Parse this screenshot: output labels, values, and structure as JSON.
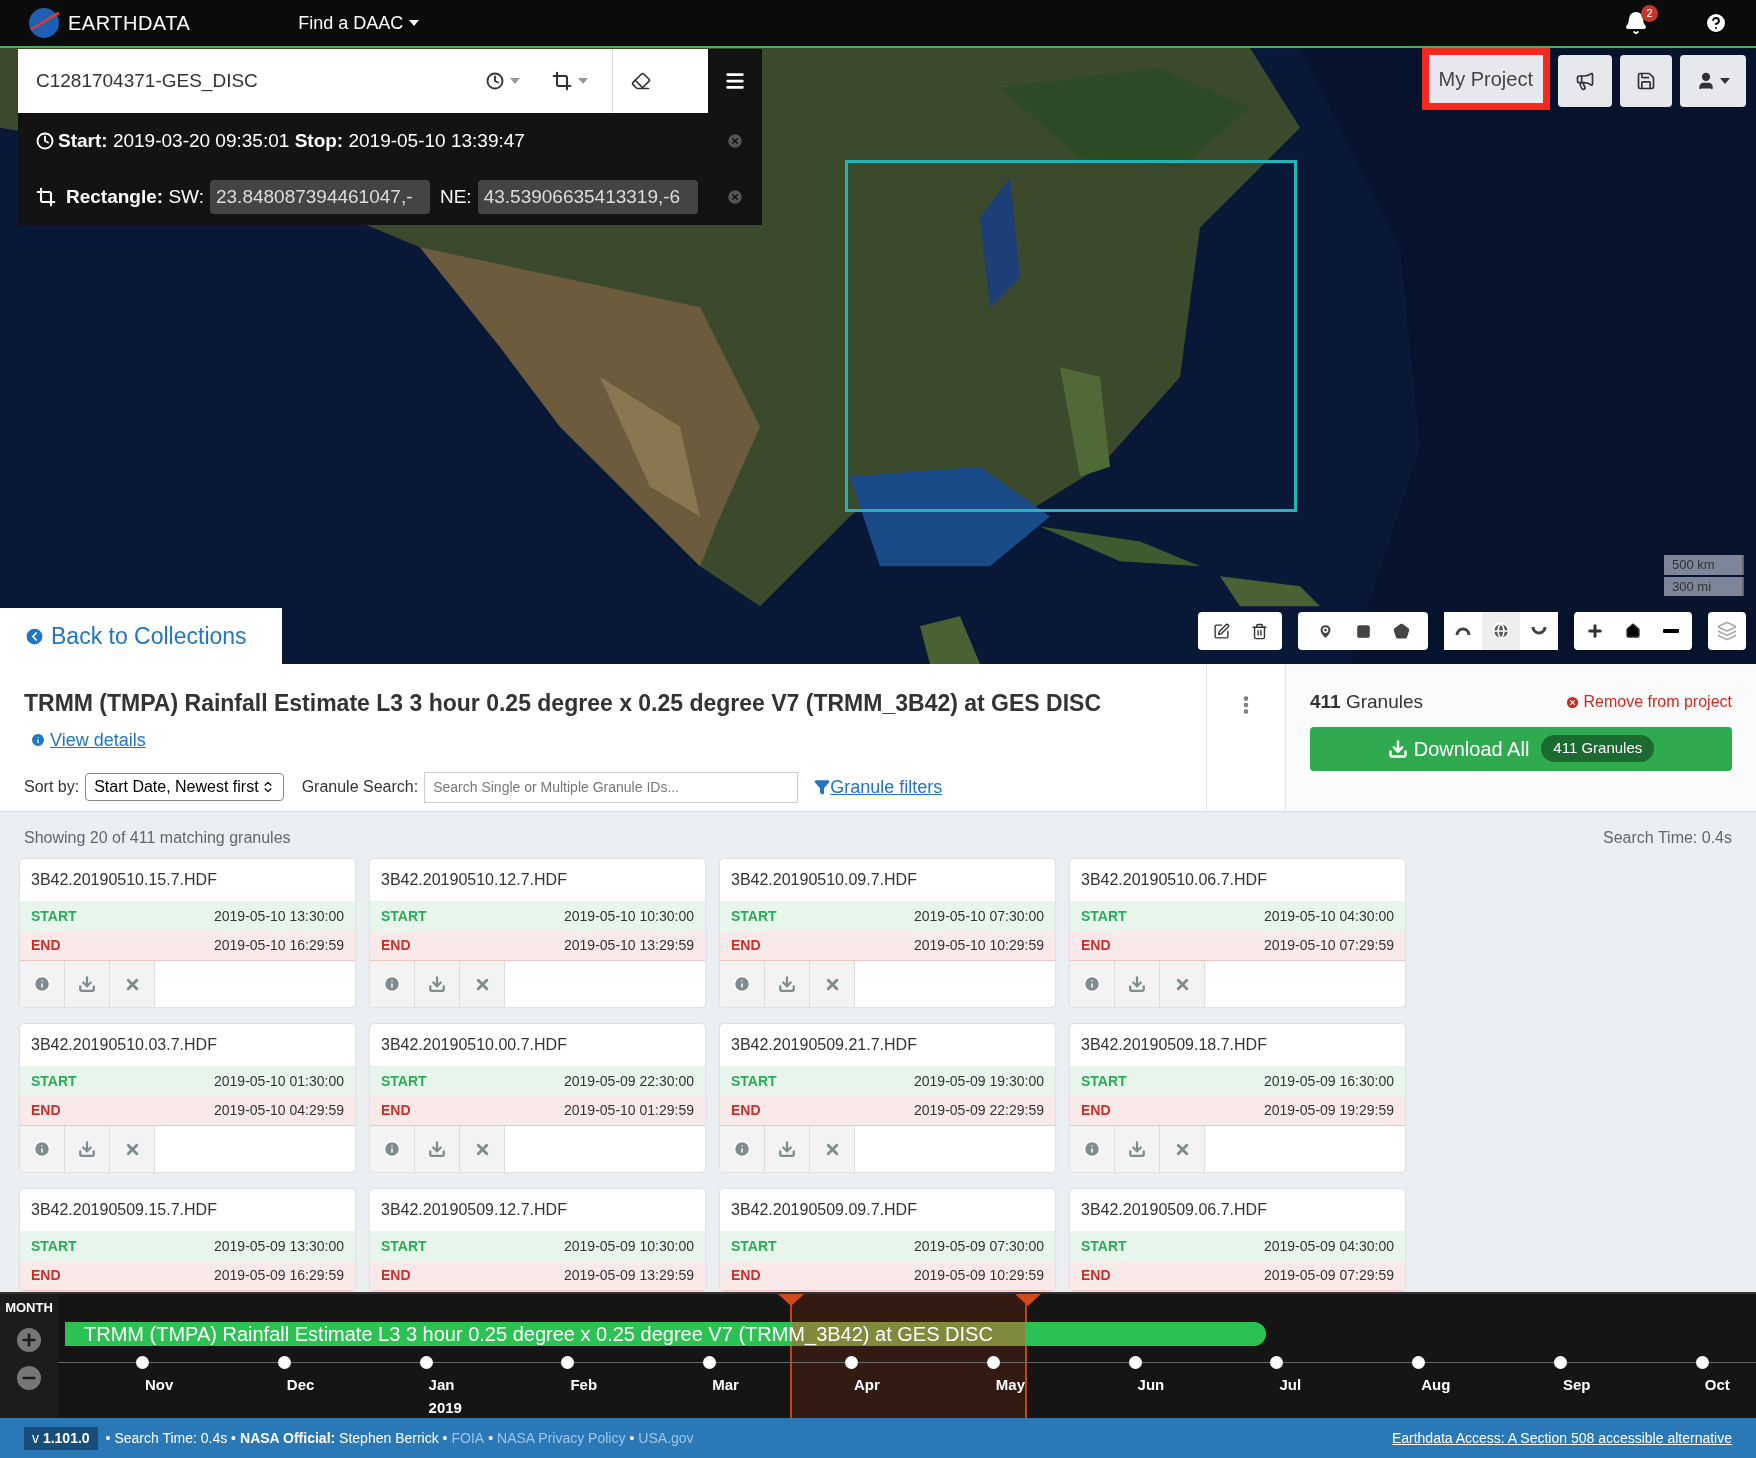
{
  "nav": {
    "brand": "EARTH**DATA**",
    "daac_menu": "Find a DAAC",
    "notification_count": "2"
  },
  "search": {
    "query": "C1281704371-GES_DISC",
    "temporal": "**Start:** 2019-03-20 09:35:01 **Stop:** 2019-05-10 13:39:47",
    "spatial_label": "**Rectangle:** SW:",
    "sw": "23.848087394461047,-",
    "ne_label": "NE:",
    "ne": "43.53906635413319,-6"
  },
  "project_button": "My Project",
  "map": {
    "scale": [
      "500 km",
      "300 mi"
    ],
    "projections": [
      {
        "selected": false
      },
      {
        "selected": true
      },
      {
        "selected": false
      }
    ]
  },
  "back_link": "Back to Collections",
  "collection": {
    "title": "TRMM (TMPA) Rainfall Estimate L3 3 hour 0.25 degree x 0.25 degree V7 (TRMM_3B42) at GES DISC",
    "details_link": "View details",
    "sort_label": "Sort by:",
    "sort_value": "Start Date, Newest first",
    "granule_search_label": "Granule Search:",
    "granule_search_placeholder": "Search Single or Multiple Granule IDs...",
    "filters_link": "Granule filters"
  },
  "project_panel": {
    "count": "**411** Granules",
    "remove": "Remove from project",
    "download": "Download All",
    "download_badge": "411 Granules"
  },
  "results": {
    "summary": "Showing 20 of 411 matching granules",
    "search_time": "Search Time: 0.4s"
  },
  "granules": [
    {
      "name": "3B42.20190510.15.7.HDF",
      "start_label": "START",
      "start": "2019-05-10 13:30:00",
      "end_label": "END",
      "end": "2019-05-10 16:29:59"
    },
    {
      "name": "3B42.20190510.12.7.HDF",
      "start_label": "START",
      "start": "2019-05-10 10:30:00",
      "end_label": "END",
      "end": "2019-05-10 13:29:59"
    },
    {
      "name": "3B42.20190510.09.7.HDF",
      "start_label": "START",
      "start": "2019-05-10 07:30:00",
      "end_label": "END",
      "end": "2019-05-10 10:29:59"
    },
    {
      "name": "3B42.20190510.06.7.HDF",
      "start_label": "START",
      "start": "2019-05-10 04:30:00",
      "end_label": "END",
      "end": "2019-05-10 07:29:59"
    },
    {
      "name": "3B42.20190510.03.7.HDF",
      "start_label": "START",
      "start": "2019-05-10 01:30:00",
      "end_label": "END",
      "end": "2019-05-10 04:29:59"
    },
    {
      "name": "3B42.20190510.00.7.HDF",
      "start_label": "START",
      "start": "2019-05-09 22:30:00",
      "end_label": "END",
      "end": "2019-05-10 01:29:59"
    },
    {
      "name": "3B42.20190509.21.7.HDF",
      "start_label": "START",
      "start": "2019-05-09 19:30:00",
      "end_label": "END",
      "end": "2019-05-09 22:29:59"
    },
    {
      "name": "3B42.20190509.18.7.HDF",
      "start_label": "START",
      "start": "2019-05-09 16:30:00",
      "end_label": "END",
      "end": "2019-05-09 19:29:59"
    },
    {
      "name": "3B42.20190509.15.7.HDF",
      "start_label": "START",
      "start": "2019-05-09 13:30:00",
      "end_label": "END",
      "end": "2019-05-09 16:29:59"
    },
    {
      "name": "3B42.20190509.12.7.HDF",
      "start_label": "START",
      "start": "2019-05-09 10:30:00",
      "end_label": "END",
      "end": "2019-05-09 13:29:59"
    },
    {
      "name": "3B42.20190509.09.7.HDF",
      "start_label": "START",
      "start": "2019-05-09 07:30:00",
      "end_label": "END",
      "end": "2019-05-09 10:29:59"
    },
    {
      "name": "3B42.20190509.06.7.HDF",
      "start_label": "START",
      "start": "2019-05-09 04:30:00",
      "end_label": "END",
      "end": "2019-05-09 07:29:59"
    }
  ],
  "timeline": {
    "zoom_label": "MONTH",
    "bar_label": "TRMM (TMPA) Rainfall Estimate L3 3 hour 0.25 degree x 0.25 degree V7 (TRMM_3B42) at GES DISC",
    "months": [
      {
        "label": "Nov"
      },
      {
        "label": "Dec"
      },
      {
        "label": "Jan",
        "year": "2019"
      },
      {
        "label": "Feb"
      },
      {
        "label": "Mar"
      },
      {
        "label": "Apr"
      },
      {
        "label": "May"
      },
      {
        "label": "Jun"
      },
      {
        "label": "Jul"
      },
      {
        "label": "Aug"
      },
      {
        "label": "Sep"
      },
      {
        "label": "Oct"
      }
    ]
  },
  "footer": {
    "version": "v **1.101.0**",
    "parts": [
      {
        "kind": "text",
        "text": "• Search Time: 0.4s •"
      },
      {
        "kind": "text",
        "text": "**NASA Official:** Stephen Berrick •"
      },
      {
        "kind": "link",
        "text": "FOIA"
      },
      {
        "kind": "text",
        "text": "•"
      },
      {
        "kind": "link",
        "text": "NASA Privacy Policy"
      },
      {
        "kind": "text",
        "text": "•"
      },
      {
        "kind": "link",
        "text": "USA.gov"
      }
    ],
    "accessibility_link": "Earthdata Access: A Section 508 accessible alternative"
  }
}
